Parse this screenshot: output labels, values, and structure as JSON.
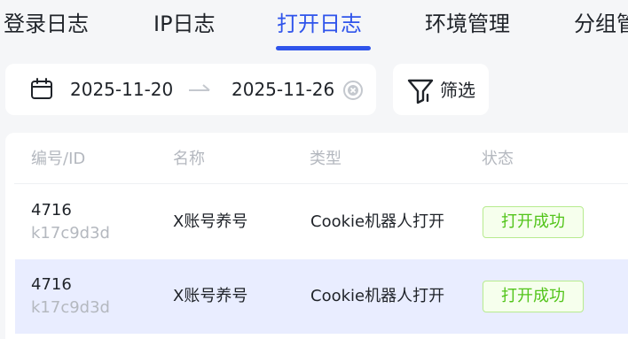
{
  "tabs": [
    {
      "label": "登录日志",
      "active": false
    },
    {
      "label": "IP日志",
      "active": false
    },
    {
      "label": "打开日志",
      "active": true
    },
    {
      "label": "环境管理",
      "active": false
    },
    {
      "label": "分组管",
      "active": false
    }
  ],
  "date_range": {
    "start": "2025-11-20",
    "end": "2025-11-26"
  },
  "filter": {
    "label": "筛选"
  },
  "table": {
    "headers": [
      "编号/ID",
      "名称",
      "类型",
      "状态"
    ],
    "rows": [
      {
        "number": "4716",
        "id": "k17c9d3d",
        "name": "X账号养号",
        "type": "Cookie机器人打开",
        "status": "打开成功"
      },
      {
        "number": "4716",
        "id": "k17c9d3d",
        "name": "X账号养号",
        "type": "Cookie机器人打开",
        "status": "打开成功"
      }
    ]
  },
  "colors": {
    "accent": "#2f54eb",
    "success": "#52c41a",
    "row_selected_bg": "#e9edff",
    "page_bg": "#f5f6f8"
  },
  "icons": [
    "calendar-icon",
    "arrow-right-icon",
    "clear-icon",
    "filter-icon"
  ]
}
